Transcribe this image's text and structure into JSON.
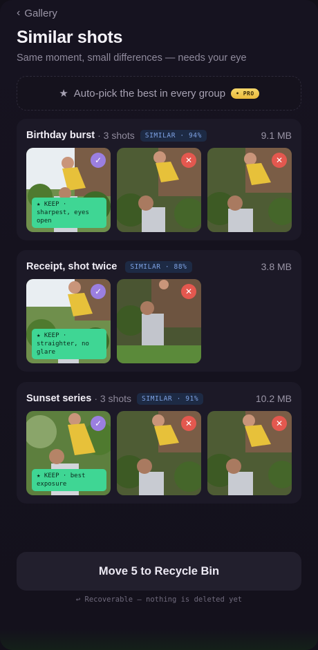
{
  "nav": {
    "back_label": "Gallery",
    "back_icon": "chevron-left-icon"
  },
  "header": {
    "title": "Similar shots",
    "subtitle": "Same moment, small differences — needs your eye"
  },
  "autopick": {
    "label": "Auto-pick the best in every group",
    "icon": "star-icon",
    "badge": "• PRO"
  },
  "groups": [
    {
      "name": "Birthday burst",
      "count": "· 3 shots",
      "badge": "SIMILAR · 94%",
      "size": "9.1 MB",
      "keep_note": "★ KEEP · sharpest, eyes open"
    },
    {
      "name": "Receipt, shot twice",
      "count": "",
      "badge": "SIMILAR · 88%",
      "size": "3.8 MB",
      "keep_note": "★ KEEP · straighter, no glare"
    },
    {
      "name": "Sunset series",
      "count": "· 3 shots",
      "badge": "SIMILAR · 91%",
      "size": "10.2 MB",
      "keep_note": "★ KEEP · best exposure"
    }
  ],
  "marks": {
    "check": "✓",
    "remove": "✕"
  },
  "footer": {
    "button_label": "Move 5 to Recycle Bin",
    "note": "↩ Recoverable — nothing is deleted yet"
  },
  "colors": {
    "accent": "#9b7fe0",
    "keep": "#3fd694",
    "remove": "#e4584f"
  }
}
